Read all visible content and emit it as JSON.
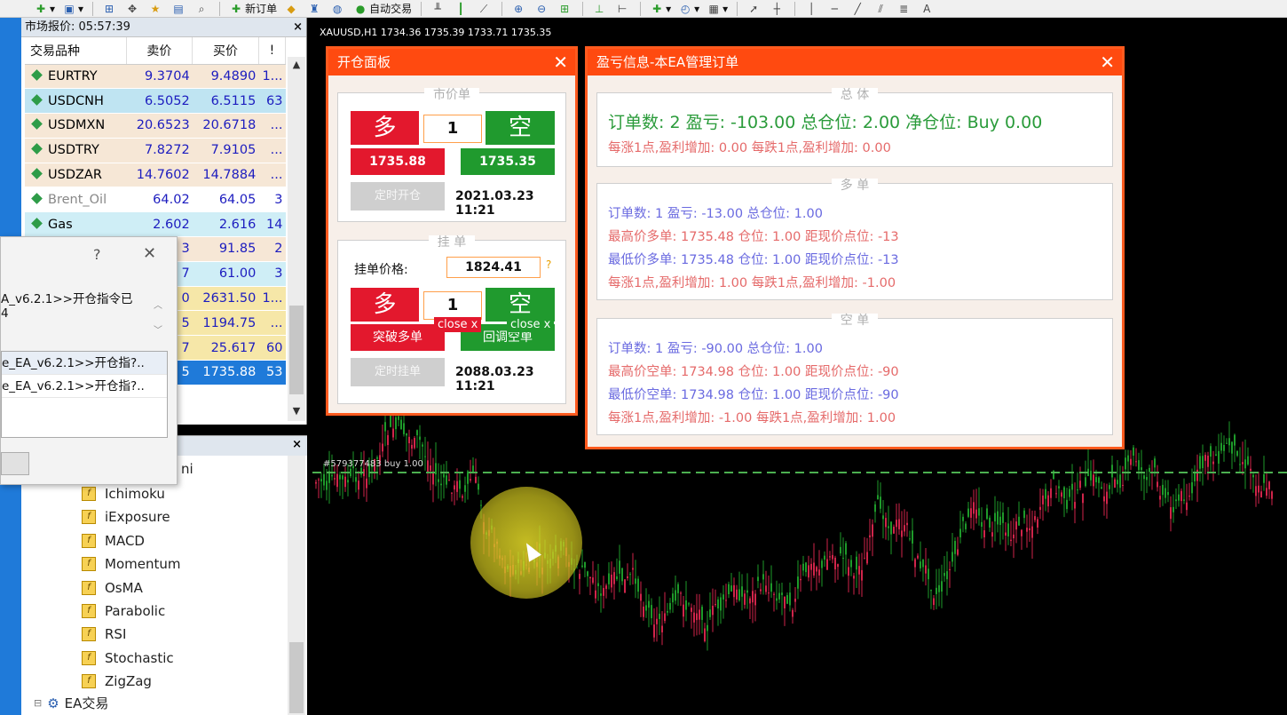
{
  "toolbar": {
    "new_order": "新订单",
    "auto_trading": "自动交易",
    "text_tool": "A"
  },
  "market_watch": {
    "title": "市场报价: 05:57:39",
    "headers": [
      "交易品种",
      "卖价",
      "买价",
      "!"
    ],
    "rows": [
      {
        "symbol": "EURTRY",
        "bid": "9.3704",
        "ask": "9.4890",
        "spread": "1...",
        "bg": "#f6e7d6"
      },
      {
        "symbol": "USDCNH",
        "bid": "6.5052",
        "ask": "6.5115",
        "spread": "63",
        "bg": "#bfe4f2"
      },
      {
        "symbol": "USDMXN",
        "bid": "20.6523",
        "ask": "20.6718",
        "spread": "...",
        "bg": "#f6e7d6"
      },
      {
        "symbol": "USDTRY",
        "bid": "7.8272",
        "ask": "7.9105",
        "spread": "...",
        "bg": "#f6e7d6"
      },
      {
        "symbol": "USDZAR",
        "bid": "14.7602",
        "ask": "14.7884",
        "spread": "...",
        "bg": "#f6e7d6"
      },
      {
        "symbol": "Brent_Oil",
        "bid": "64.02",
        "ask": "64.05",
        "spread": "3",
        "bg": "#ffffff"
      },
      {
        "symbol": "Gas",
        "bid": "2.602",
        "ask": "2.616",
        "spread": "14",
        "bg": "#cfeef6"
      },
      {
        "symbol": "",
        "bid": "3",
        "ask": "91.85",
        "spread": "2",
        "bg": "#f6e7d6"
      },
      {
        "symbol": "",
        "bid": "7",
        "ask": "61.00",
        "spread": "3",
        "bg": "#cfeef6"
      },
      {
        "symbol": "",
        "bid": "0",
        "ask": "2631.50",
        "spread": "1...",
        "bg": "#f6e7a8"
      },
      {
        "symbol": "",
        "bid": "5",
        "ask": "1194.75",
        "spread": "...",
        "bg": "#f6e7a8"
      },
      {
        "symbol": "",
        "bid": "7",
        "ask": "25.617",
        "spread": "60",
        "bg": "#f6e7a8"
      },
      {
        "symbol": "",
        "bid": "5",
        "ask": "1735.88",
        "spread": "53",
        "bg": "#1f7ad9"
      }
    ]
  },
  "navigator": {
    "partial_label": "ni",
    "items": [
      "Ichimoku",
      "iExposure",
      "MACD",
      "Momentum",
      "OsMA",
      "Parabolic",
      "RSI",
      "Stochastic",
      "ZigZag"
    ],
    "ea_group": "EA交易"
  },
  "dialog": {
    "help": "?",
    "close": "✕",
    "message_line1": "A_v6.2.1>>开仓指令已",
    "message_line2": "4",
    "list": [
      "e_EA_v6.2.1>>开仓指?..",
      "e_EA_v6.2.1>>开仓指?.."
    ]
  },
  "chart": {
    "header": "XAUUSD,H1  1734.36 1735.39 1733.71 1735.35",
    "order_line_label": "#579377483 buy 1.00"
  },
  "open_panel": {
    "title": "开仓面板",
    "close": "✕",
    "market_section": "市价单",
    "long": "多",
    "short": "空",
    "qty": "1",
    "buy_price": "1735.88",
    "sell_price": "1735.35",
    "timed_open": "定时开仓",
    "time1": "2021.03.23 11:21",
    "pending_section": "挂  单",
    "pending_price_label": "挂单价格:",
    "pending_price": "1824.41",
    "help_mark": "?",
    "pending_qty": "1",
    "breakout_long": "突破多单",
    "pullback_short": "回调空单",
    "close_tag": "close x",
    "timed_pending": "定时挂单",
    "time2": "2088.03.23 11:21"
  },
  "pl_panel": {
    "title": "盈亏信息-本EA管理订单",
    "close": "✕",
    "total_section": "总  体",
    "total_main": "订单数: 2  盈亏: -103.00  总仓位: 2.00  净仓位: Buy 0.00",
    "total_sub": "每涨1点,盈利增加: 0.00    每跌1点,盈利增加: 0.00",
    "long_section": "多  单",
    "long_l1": "订单数: 1  盈亏: -13.00  总仓位: 1.00",
    "long_l2": "最高价多单: 1735.48  仓位: 1.00  距现价点位: -13",
    "long_l3": "最低价多单: 1735.48  仓位: 1.00  距现价点位: -13",
    "long_l4": "每涨1点,盈利增加: 1.00    每跌1点,盈利增加: -1.00",
    "short_section": "空  单",
    "short_l1": "订单数: 1  盈亏: -90.00  总仓位: 1.00",
    "short_l2": "最高价空单: 1734.98  仓位: 1.00  距现价点位: -90",
    "short_l3": "最低价空单: 1734.98  仓位: 1.00  距现价点位: -90",
    "short_l4": "每涨1点,盈利增加: -1.00    每跌1点,盈利增加: 1.00"
  },
  "colors": {
    "panel_border": "#ff5a1e",
    "buy_red": "#e3182d",
    "sell_green": "#209a2e",
    "candle_bull": "#1e9a2a",
    "candle_bear": "#d0254a",
    "order_line": "#4caf50"
  }
}
